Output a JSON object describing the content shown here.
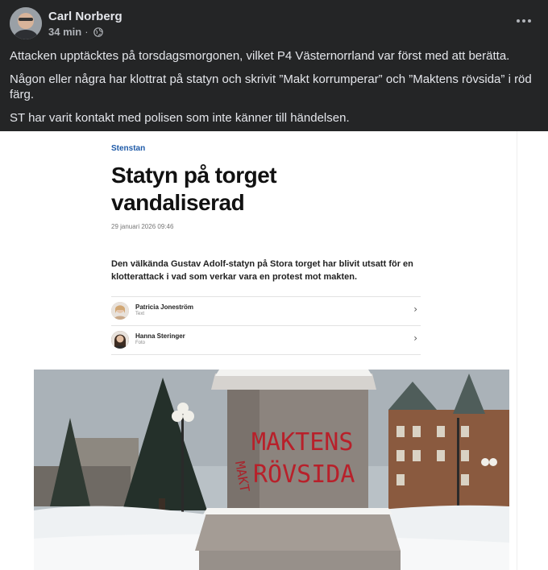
{
  "post": {
    "author": "Carl Norberg",
    "time": "34 min",
    "separator": "·",
    "privacy_icon": "globe-icon",
    "more_icon": "more-options-icon",
    "paragraphs": [
      "Attacken upptäcktes på torsdagsmorgonen, vilket P4 Västernorrland var först med att berätta.",
      "Någon eller några har klottrat på statyn och skrivit ”Makt korrumperar” och ”Maktens rövsida” i röd färg.",
      "ST har varit kontakt med polisen som inte känner till händelsen."
    ]
  },
  "article": {
    "kicker": "Stenstan",
    "headline_line1": "Statyn på torget",
    "headline_line2": "vandaliserad",
    "date": "29 januari 2026 09:46",
    "lead": "Den välkända Gustav Adolf-statyn på Stora torget har blivit utsatt för en klotterattack i vad som verkar vara en protest mot makten.",
    "bylines": [
      {
        "name": "Patricia Joneström",
        "role": "Text"
      },
      {
        "name": "Hanna Steringer",
        "role": "Foto"
      }
    ],
    "chevron": "›"
  },
  "photo": {
    "graffiti_line1": "MAKTENS",
    "graffiti_line2": "RÖVSIDA",
    "graffiti_side": "MAKT"
  },
  "colors": {
    "background": "#242526",
    "text": "#e4e6eb",
    "secondary": "#b0b3b8",
    "kicker": "#1e5aa8",
    "graffiti": "#b8202a"
  }
}
